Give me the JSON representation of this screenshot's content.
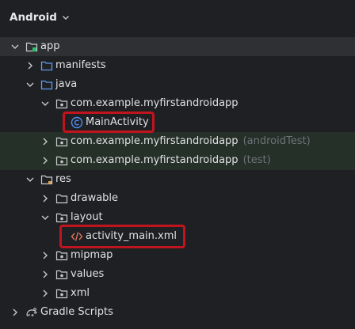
{
  "header": {
    "title": "Android"
  },
  "tree": {
    "app": "app",
    "manifests": "manifests",
    "java": "java",
    "pkg_main": "com.example.myfirstandroidapp",
    "main_activity": "MainActivity",
    "pkg_android_test": "com.example.myfirstandroidapp",
    "pkg_android_test_suffix": "(androidTest)",
    "pkg_test": "com.example.myfirstandroidapp",
    "pkg_test_suffix": "(test)",
    "res": "res",
    "drawable": "drawable",
    "layout": "layout",
    "activity_main": "activity_main.xml",
    "mipmap": "mipmap",
    "values": "values",
    "xml": "xml",
    "gradle_scripts": "Gradle Scripts"
  },
  "colors": {
    "background": "#1f2023",
    "selection": "#2e3034",
    "test_row": "#253028",
    "highlight": "#c0141e",
    "folder_blue": "#5f9bf0",
    "class_icon": "#4e8cf0",
    "xml_icon": "#d9745a"
  }
}
